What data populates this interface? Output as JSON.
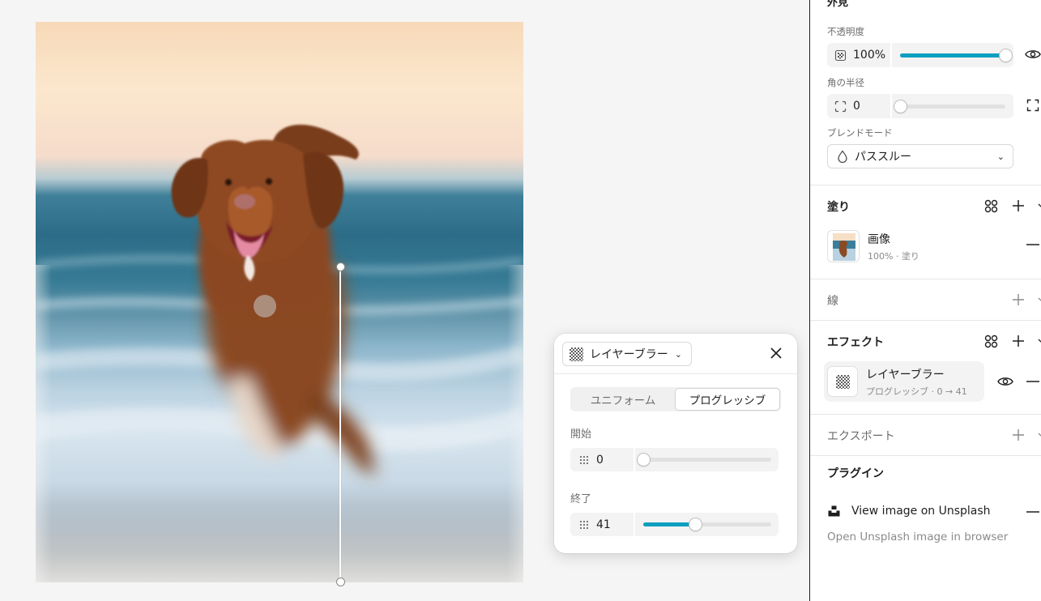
{
  "popover": {
    "effect_type": "レイヤーブラー",
    "tabs": [
      "ユニフォーム",
      "プログレッシブ"
    ],
    "active_tab": 1,
    "start_label": "開始",
    "start_value": "0",
    "start_fraction": 0.0,
    "end_label": "終了",
    "end_value": "41",
    "end_fraction": 0.41
  },
  "panel": {
    "appearance_title": "外見",
    "opacity_label": "不透明度",
    "opacity_value": "100%",
    "opacity_fraction": 1.0,
    "radius_label": "角の半径",
    "radius_value": "0",
    "radius_fraction": 0.0,
    "blend_label": "ブレンドモード",
    "blend_value": "パススルー",
    "fill_title": "塗り",
    "fill_item_title": "画像",
    "fill_item_sub": "100% · 塗り",
    "stroke_title": "線",
    "effects_title": "エフェクト",
    "effect_item_title": "レイヤーブラー",
    "effect_item_sub": "プログレッシブ · 0 → 41",
    "export_title": "エクスポート",
    "plugins_title": "プラグイン",
    "plugin_name": "View image on Unsplash",
    "plugin_desc": "Open Unsplash image in browser"
  },
  "colors": {
    "accent": "#0d9fbf",
    "panel_border": "#1e1e1e",
    "canvas_bg": "#f5f5f5"
  },
  "icons": {
    "opacity": "opacity-icon",
    "eye": "eye-icon",
    "radius": "corner-radius-icon",
    "expand": "independent-corners-icon",
    "drop": "drop-icon",
    "styles": "styles-grid-icon",
    "plus": "plus-icon",
    "chevron": "chevron-down-icon",
    "minus": "minus-icon",
    "close": "close-icon",
    "unsplash": "unsplash-logo-icon"
  }
}
